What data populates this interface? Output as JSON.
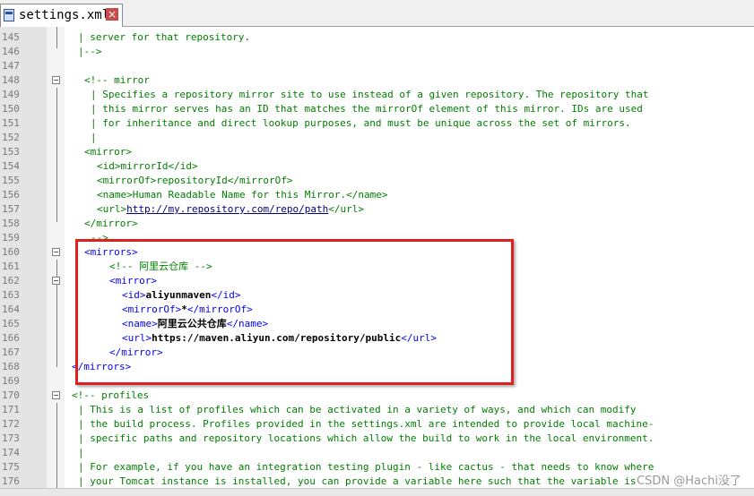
{
  "tab": {
    "filename": "settings.xml",
    "close_glyph": "×"
  },
  "watermark": "CSDN @Hachi没了",
  "lines": [
    {
      "n": "145",
      "segs": [
        {
          "c": "comment",
          "t": "| server for that repository."
        }
      ],
      "indent": 2
    },
    {
      "n": "146",
      "segs": [
        {
          "c": "comment",
          "t": "|-->"
        }
      ],
      "indent": 2
    },
    {
      "n": "147",
      "segs": [],
      "indent": 0
    },
    {
      "n": "148",
      "segs": [
        {
          "c": "comment",
          "t": "<!-- mirror"
        }
      ],
      "indent": 3
    },
    {
      "n": "149",
      "segs": [
        {
          "c": "comment",
          "t": "| Specifies a repository mirror site to use instead of a given repository. The repository that"
        }
      ],
      "indent": 4
    },
    {
      "n": "150",
      "segs": [
        {
          "c": "comment",
          "t": "| this mirror serves has an ID that matches the mirrorOf element of this mirror. IDs are used"
        }
      ],
      "indent": 4
    },
    {
      "n": "151",
      "segs": [
        {
          "c": "comment",
          "t": "| for inheritance and direct lookup purposes, and must be unique across the set of mirrors."
        }
      ],
      "indent": 4
    },
    {
      "n": "152",
      "segs": [
        {
          "c": "comment",
          "t": "|"
        }
      ],
      "indent": 4
    },
    {
      "n": "153",
      "segs": [
        {
          "c": "comment",
          "t": "<mirror>"
        }
      ],
      "indent": 3
    },
    {
      "n": "154",
      "segs": [
        {
          "c": "comment",
          "t": "<id>mirrorId</id>"
        }
      ],
      "indent": 5
    },
    {
      "n": "155",
      "segs": [
        {
          "c": "comment",
          "t": "<mirrorOf>repositoryId</mirrorOf>"
        }
      ],
      "indent": 5
    },
    {
      "n": "156",
      "segs": [
        {
          "c": "comment",
          "t": "<name>Human Readable Name for this Mirror.</name>"
        }
      ],
      "indent": 5
    },
    {
      "n": "157",
      "segs": [
        {
          "c": "comment",
          "t": "<url>"
        },
        {
          "c": "comment url",
          "t": "http://my.repository.com/repo/path"
        },
        {
          "c": "comment",
          "t": "</url>"
        }
      ],
      "indent": 5
    },
    {
      "n": "158",
      "segs": [
        {
          "c": "comment",
          "t": "</mirror>"
        }
      ],
      "indent": 3
    },
    {
      "n": "159",
      "segs": [
        {
          "c": "comment",
          "t": "-->"
        }
      ],
      "indent": 4
    },
    {
      "n": "160",
      "segs": [
        {
          "c": "tag",
          "t": "<mirrors>"
        }
      ],
      "indent": 3
    },
    {
      "n": "161",
      "segs": [
        {
          "c": "comment",
          "t": "<!-- 阿里云仓库 -->"
        }
      ],
      "indent": 7
    },
    {
      "n": "162",
      "segs": [
        {
          "c": "tag",
          "t": "<mirror>"
        }
      ],
      "indent": 7
    },
    {
      "n": "163",
      "segs": [
        {
          "c": "tag",
          "t": "<id>"
        },
        {
          "c": "text bold",
          "t": "aliyunmaven"
        },
        {
          "c": "tag",
          "t": "</id>"
        }
      ],
      "indent": 9
    },
    {
      "n": "164",
      "segs": [
        {
          "c": "tag",
          "t": "<mirrorOf>"
        },
        {
          "c": "text bold",
          "t": "*"
        },
        {
          "c": "tag",
          "t": "</mirrorOf>"
        }
      ],
      "indent": 9
    },
    {
      "n": "165",
      "segs": [
        {
          "c": "tag",
          "t": "<name>"
        },
        {
          "c": "text bold",
          "t": "阿里云公共仓库"
        },
        {
          "c": "tag",
          "t": "</name>"
        }
      ],
      "indent": 9
    },
    {
      "n": "166",
      "segs": [
        {
          "c": "tag",
          "t": "<url>"
        },
        {
          "c": "text bold",
          "t": "https://maven.aliyun.com/repository/public"
        },
        {
          "c": "tag",
          "t": "</url>"
        }
      ],
      "indent": 9
    },
    {
      "n": "167",
      "segs": [
        {
          "c": "tag",
          "t": "</mirror>"
        }
      ],
      "indent": 7
    },
    {
      "n": "168",
      "segs": [
        {
          "c": "tag",
          "t": "</mirrors>"
        }
      ],
      "indent": 1
    },
    {
      "n": "169",
      "segs": [],
      "indent": 0
    },
    {
      "n": "170",
      "segs": [
        {
          "c": "comment",
          "t": "<!-- profiles"
        }
      ],
      "indent": 1
    },
    {
      "n": "171",
      "segs": [
        {
          "c": "comment",
          "t": "| This is a list of profiles which can be activated in a variety of ways, and which can modify"
        }
      ],
      "indent": 2
    },
    {
      "n": "172",
      "segs": [
        {
          "c": "comment",
          "t": "| the build process. Profiles provided in the settings.xml are intended to provide local machine-"
        }
      ],
      "indent": 2
    },
    {
      "n": "173",
      "segs": [
        {
          "c": "comment",
          "t": "| specific paths and repository locations which allow the build to work in the local environment."
        }
      ],
      "indent": 2
    },
    {
      "n": "174",
      "segs": [
        {
          "c": "comment",
          "t": "|"
        }
      ],
      "indent": 2
    },
    {
      "n": "175",
      "segs": [
        {
          "c": "comment",
          "t": "| For example, if you have an integration testing plugin - like cactus - that needs to know where"
        }
      ],
      "indent": 2
    },
    {
      "n": "176",
      "segs": [
        {
          "c": "comment",
          "t": "| your Tomcat instance is installed, you can provide a variable here such that the variable is"
        }
      ],
      "indent": 2
    }
  ],
  "fold_lines": [
    "148",
    "160",
    "162",
    "170"
  ]
}
